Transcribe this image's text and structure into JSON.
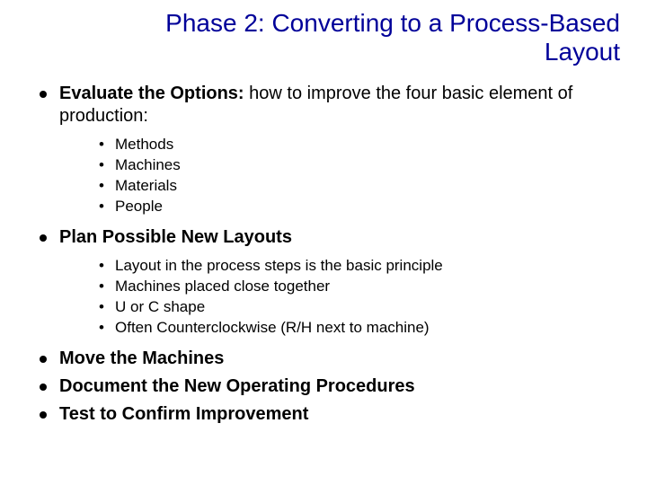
{
  "title": "Phase 2: Converting to a Process-Based Layout",
  "bullets": [
    {
      "lead": "Evaluate the Options:",
      "rest": " how to improve the four basic element of production:",
      "sub": [
        "Methods",
        "Machines",
        "Materials",
        "People"
      ]
    },
    {
      "lead": "Plan Possible New Layouts",
      "rest": "",
      "sub": [
        "Layout in the process steps is the basic principle",
        "Machines placed close together",
        "U or C shape",
        "Often Counterclockwise (R/H next to machine)"
      ]
    },
    {
      "lead": "Move the Machines",
      "rest": "",
      "sub": []
    },
    {
      "lead": "Document the New Operating Procedures",
      "rest": "",
      "sub": []
    },
    {
      "lead": "Test to Confirm Improvement",
      "rest": "",
      "sub": []
    }
  ]
}
